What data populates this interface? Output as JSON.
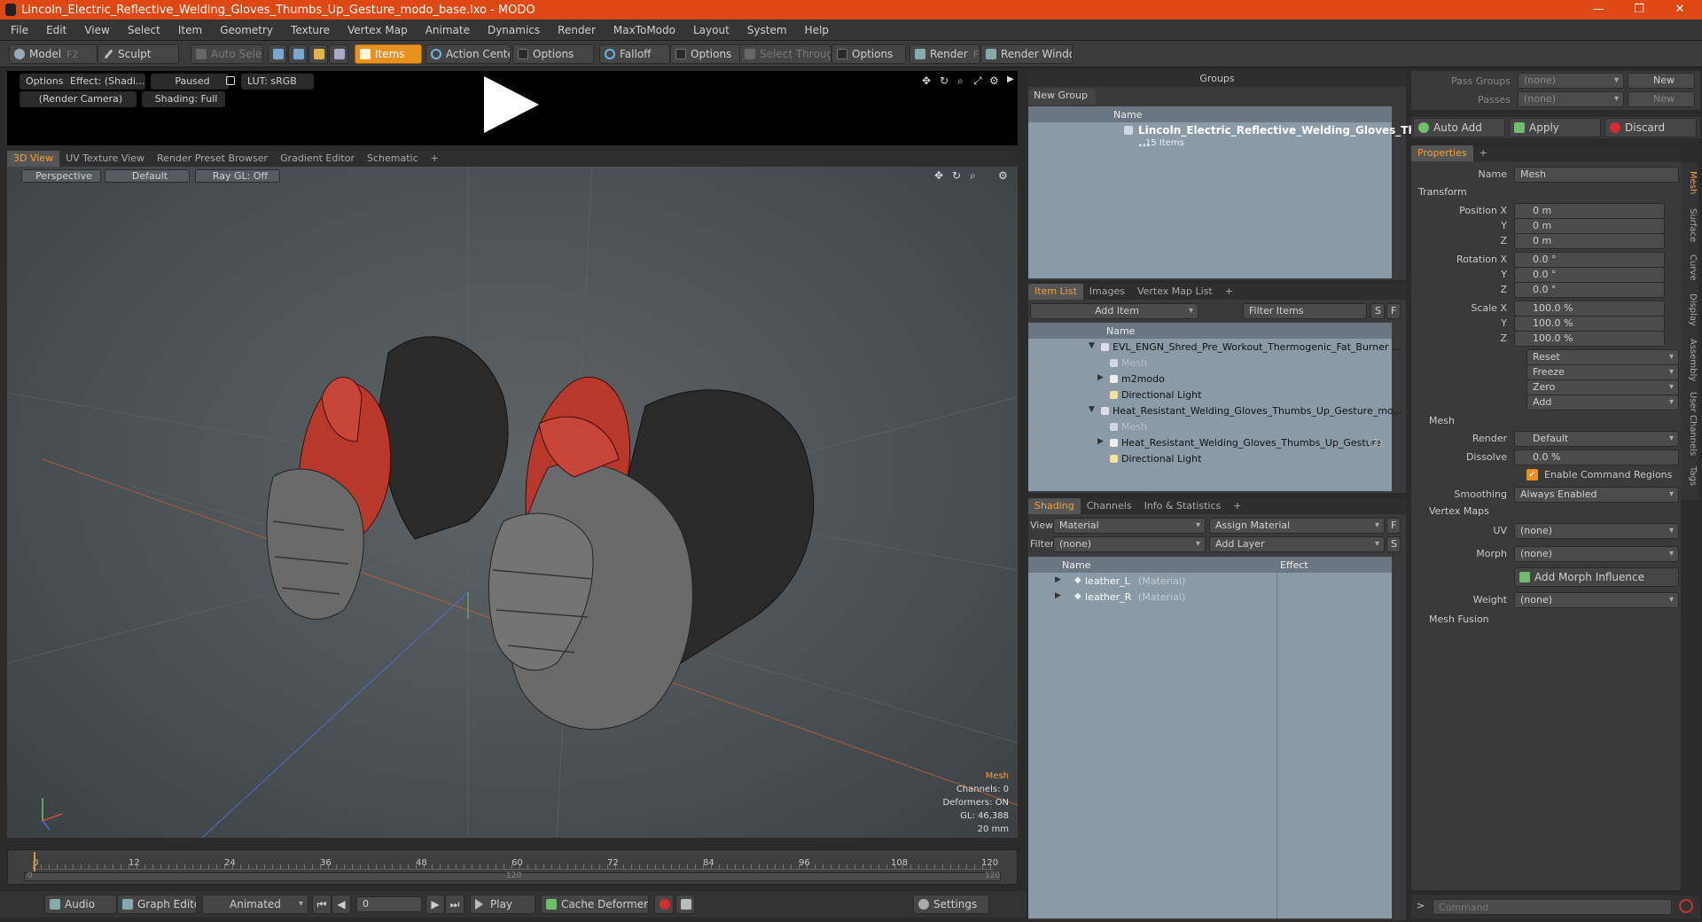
{
  "window": {
    "title": "Lincoln_Electric_Reflective_Welding_Gloves_Thumbs_Up_Gesture_modo_base.lxo - MODO",
    "minimize": "—",
    "maximize": "❐",
    "close": "✕"
  },
  "menu": [
    "File",
    "Edit",
    "View",
    "Select",
    "Item",
    "Geometry",
    "Texture",
    "Vertex Map",
    "Animate",
    "Dynamics",
    "Render",
    "MaxToModo",
    "Layout",
    "System",
    "Help"
  ],
  "toolbar": {
    "model": "Model",
    "model_key": "F2",
    "sculpt": "Sculpt",
    "auto_select": "Auto Select",
    "items": "Items",
    "action_center": "Action Center",
    "options1": "Options",
    "falloff": "Falloff",
    "options2": "Options",
    "select_through": "Select Through",
    "options3": "Options",
    "render": "Render",
    "render_key": "F9",
    "render_window": "Render Window"
  },
  "preview": {
    "options": "Options",
    "effect": "Effect: (Shadi...",
    "paused": "Paused",
    "lut": "LUT: sRGB",
    "camera": "(Render Camera)",
    "shading": "Shading: Full"
  },
  "viewport_tabs": [
    "3D View",
    "UV Texture View",
    "Render Preset Browser",
    "Gradient Editor",
    "Schematic",
    "+"
  ],
  "viewport": {
    "perspective": "Perspective",
    "default": "Default",
    "raygl": "Ray GL: Off",
    "info": {
      "mesh": "Mesh",
      "channels": "Channels: 0",
      "deformers": "Deformers: ON",
      "gl": "GL: 46,388",
      "scale": "20 mm"
    }
  },
  "timeline": {
    "ticks": [
      "0",
      "12",
      "24",
      "36",
      "48",
      "60",
      "72",
      "84",
      "96",
      "108",
      "120"
    ],
    "sub_start": "0",
    "sub_mid": "120",
    "sub_end": "120"
  },
  "transport": {
    "audio": "Audio",
    "graph_editor": "Graph Editor",
    "animated": "Animated",
    "frame": "0",
    "play": "Play",
    "cache": "Cache Deformers",
    "settings": "Settings"
  },
  "groups": {
    "title": "Groups",
    "new_group": "New Group",
    "col_name": "Name",
    "item_name": "Lincoln_Electric_Reflective_Welding_Gloves_Th ...",
    "item_count": "15 Items"
  },
  "itemlist": {
    "tabs": [
      "Item List",
      "Images",
      "Vertex Map List",
      "+"
    ],
    "add_item": "Add Item",
    "filter": "Filter Items",
    "s": "S",
    "f": "F",
    "col_name": "Name",
    "rows": [
      {
        "label": "EVL_ENGN_Shred_Pre_Workout_Thermogenic_Fat_Burner ...",
        "indent": 0,
        "type": "group",
        "dim": false
      },
      {
        "label": "Mesh",
        "indent": 1,
        "type": "mesh",
        "dim": true
      },
      {
        "label": "m2modo",
        "indent": 1,
        "type": "loc",
        "dim": false
      },
      {
        "label": "Directional Light",
        "indent": 1,
        "type": "light",
        "dim": false
      },
      {
        "label": "Heat_Resistant_Welding_Gloves_Thumbs_Up_Gesture_mo...",
        "indent": 0,
        "type": "group",
        "dim": false
      },
      {
        "label": "Mesh",
        "indent": 1,
        "type": "mesh",
        "dim": true
      },
      {
        "label": "Heat_Resistant_Welding_Gloves_Thumbs_Up_Gesture",
        "indent": 1,
        "type": "loc",
        "dim": false,
        "suffix": "(3)"
      },
      {
        "label": "Directional Light",
        "indent": 1,
        "type": "light",
        "dim": false
      }
    ]
  },
  "shading": {
    "tabs": [
      "Shading",
      "Channels",
      "Info & Statistics",
      "+"
    ],
    "view_label": "View",
    "view_value": "Material",
    "assign": "Assign Material",
    "f": "F",
    "filter_label": "Filter",
    "filter_value": "(none)",
    "add_layer": "Add Layer",
    "s": "S",
    "col_name": "Name",
    "col_effect": "Effect",
    "rows": [
      {
        "name": "leather_L",
        "type": "(Material)"
      },
      {
        "name": "leather_R",
        "type": "(Material)"
      }
    ]
  },
  "passes": {
    "pass_groups": "Pass Groups",
    "passes": "Passes",
    "none1": "(none)",
    "none2": "(none)",
    "new1": "New",
    "new2": "New"
  },
  "actions": {
    "auto_add": "Auto Add",
    "apply": "Apply",
    "discard": "Discard"
  },
  "properties": {
    "tab": "Properties",
    "plus": "+",
    "name_label": "Name",
    "name_value": "Mesh",
    "transform": "Transform",
    "position_label": "Position X",
    "rotation_label": "Rotation X",
    "scale_label": "Scale X",
    "y": "Y",
    "z": "Z",
    "pos": [
      "0 m",
      "0 m",
      "0 m"
    ],
    "rot": [
      "0.0 °",
      "0.0 °",
      "0.0 °"
    ],
    "scl": [
      "100.0 %",
      "100.0 %",
      "100.0 %"
    ],
    "reset": "Reset",
    "freeze": "Freeze",
    "zero": "Zero",
    "add": "Add",
    "mesh": "Mesh",
    "render_label": "Render",
    "render_value": "Default",
    "dissolve_label": "Dissolve",
    "dissolve_value": "0.0 %",
    "enable_cmd": "Enable Command Regions",
    "smoothing_label": "Smoothing",
    "smoothing_value": "Always Enabled",
    "vertex_maps": "Vertex Maps",
    "uv_label": "UV",
    "uv_value": "(none)",
    "morph_label": "Morph",
    "morph_value": "(none)",
    "add_morph": "Add Morph Influence",
    "weight_label": "Weight",
    "weight_value": "(none)",
    "mesh_fusion": "Mesh Fusion"
  },
  "side_tabs": [
    "Mesh",
    "Surface",
    "Curve",
    "Display",
    "Assembly",
    "User Channels",
    "Tags"
  ],
  "command": {
    "placeholder": "Command"
  },
  "colors": {
    "accent": "#e8911f",
    "title": "#dd4814",
    "glove_red": "#b8382c",
    "glove_dark": "#2a2a2a",
    "glove_grey": "#6a6a6a"
  }
}
